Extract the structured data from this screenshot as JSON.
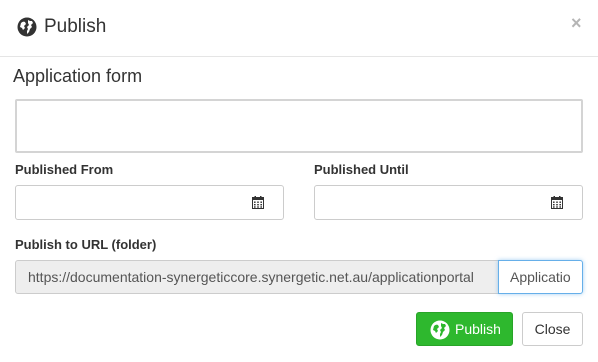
{
  "dialog": {
    "title": "Publish",
    "title_icon": "globe-icon",
    "close_glyph": "×"
  },
  "form": {
    "section_title": "Application form",
    "application_form_value": "",
    "published_from": {
      "label": "Published From",
      "value": "",
      "icon": "calendar-icon"
    },
    "published_until": {
      "label": "Published Until",
      "value": "",
      "icon": "calendar-icon"
    },
    "publish_url": {
      "label": "Publish to URL (folder)",
      "base_url": "https://documentation-synergeticcore.synergetic.net.au/applicationportal",
      "folder_value": "Applicatio"
    }
  },
  "footer": {
    "publish_label": "Publish",
    "close_label": "Close"
  },
  "colors": {
    "publish_button": "#2eb82e",
    "focus_border": "#66afe9",
    "addon_background": "#eeeeee"
  }
}
